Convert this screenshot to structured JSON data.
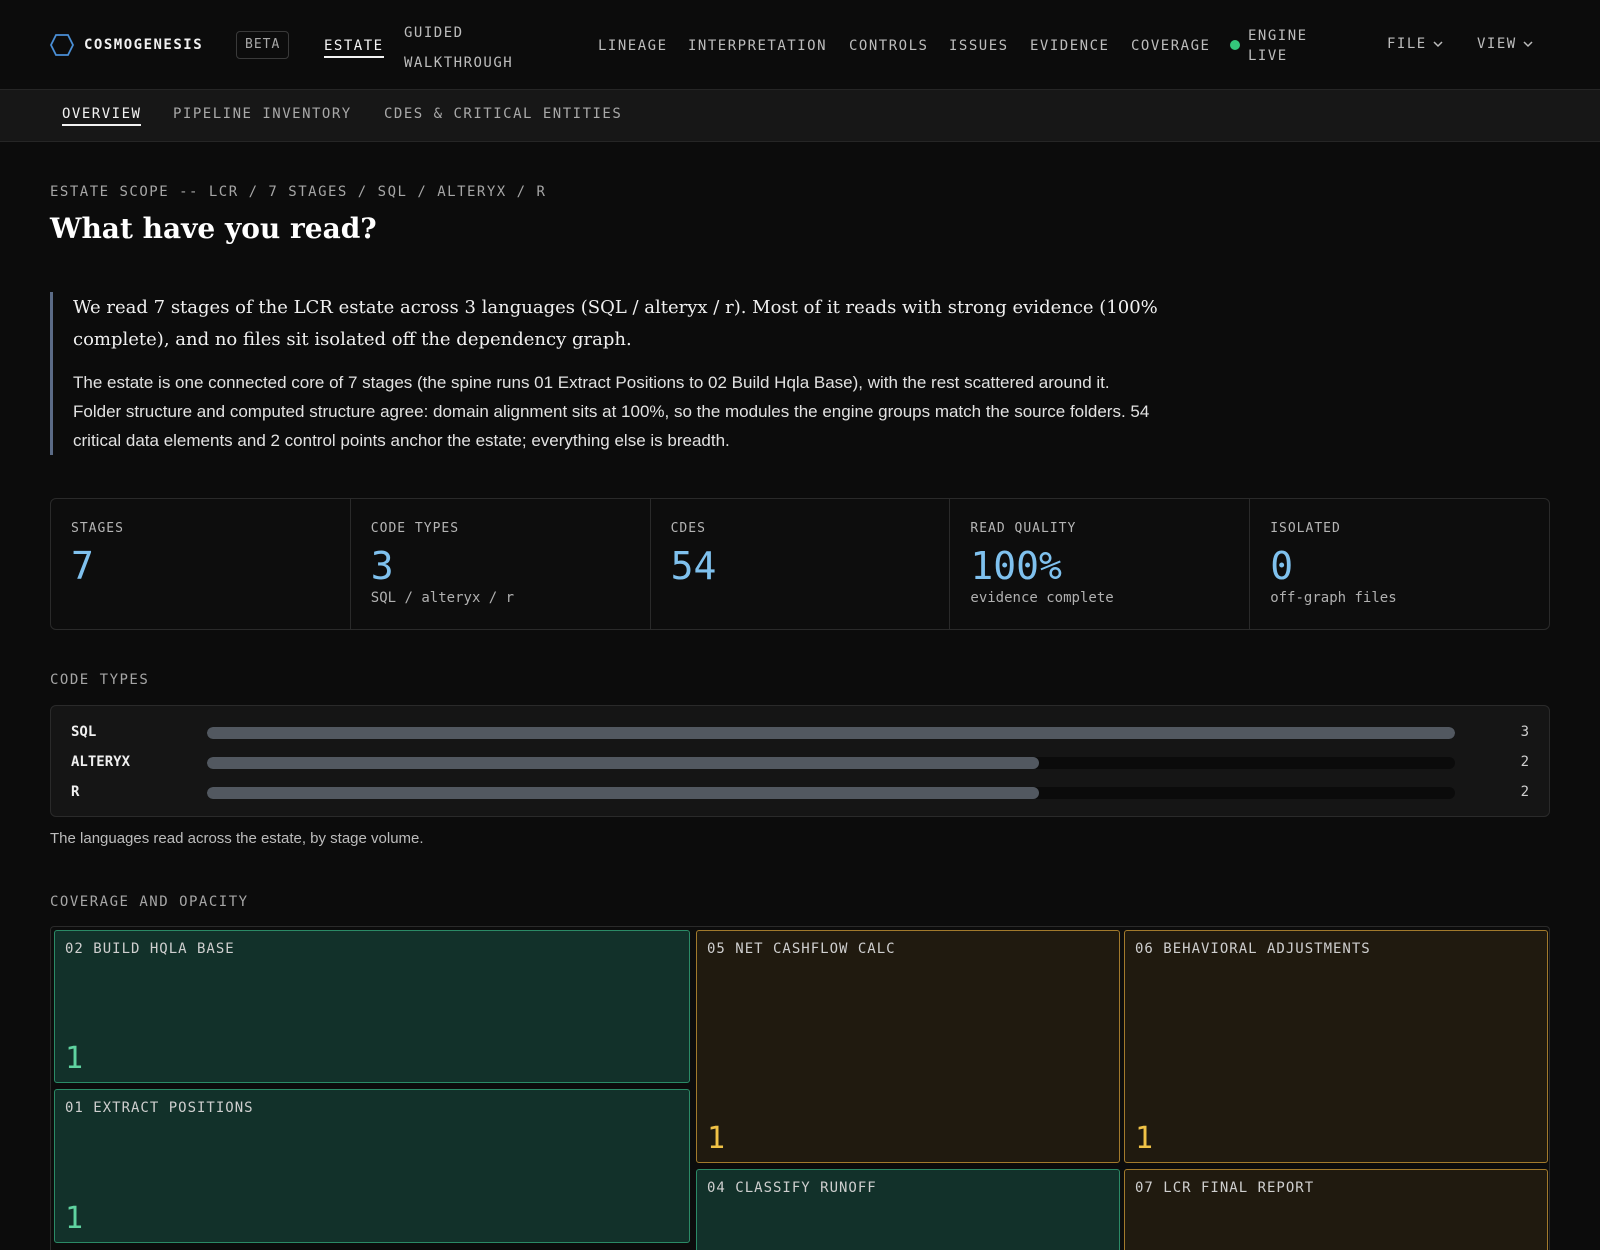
{
  "nav": {
    "brand": "COSMOGENESIS",
    "badge": "BETA",
    "links": {
      "estate": "ESTATE",
      "guided": "GUIDED WALKTHROUGH",
      "lineage": "LINEAGE",
      "interpretation": "INTERPRETATION",
      "controls": "CONTROLS",
      "issues": "ISSUES",
      "evidence": "EVIDENCE",
      "coverage": "COVERAGE"
    },
    "engine_status": "ENGINE LIVE",
    "engine_color": "#34c77b",
    "file_menu": "FILE",
    "view_menu": "VIEW"
  },
  "subnav": {
    "overview": "OVERVIEW",
    "pipeline": "PIPELINE INVENTORY",
    "cdes": "CDES & CRITICAL ENTITIES"
  },
  "header": {
    "scope": "ESTATE SCOPE -- LCR / 7 STAGES / SQL / ALTERYX / R",
    "title": "What have you read?"
  },
  "summary": {
    "lead": "We read 7 stages of the LCR estate across 3 languages (SQL / alteryx / r). Most of it reads with strong evidence (100% complete), and no files sit isolated off the dependency graph.",
    "body": "The estate is one connected core of 7 stages (the spine runs 01 Extract Positions to 02 Build Hqla Base), with the rest scattered around it. Folder structure and computed structure agree: domain alignment sits at 100%, so the modules the engine groups match the source folders. 54 critical data elements and 2 control points anchor the estate; everything else is breadth."
  },
  "stats": {
    "stages": {
      "label": "STAGES",
      "value": "7"
    },
    "code_types": {
      "label": "CODE TYPES",
      "value": "3",
      "sub": "SQL / alteryx / r"
    },
    "cdes": {
      "label": "CDES",
      "value": "54"
    },
    "read_quality": {
      "label": "READ QUALITY",
      "value": "100%",
      "sub": "evidence complete"
    },
    "isolated": {
      "label": "ISOLATED",
      "value": "0",
      "sub": "off-graph files"
    }
  },
  "code_types": {
    "section_label": "CODE TYPES",
    "caption": "The languages read across the estate, by stage volume.",
    "max": 3,
    "rows": [
      {
        "name": "SQL",
        "count": 3
      },
      {
        "name": "ALTERYX",
        "count": 2
      },
      {
        "name": "R",
        "count": 2
      }
    ]
  },
  "coverage": {
    "section_label": "COVERAGE AND OPACITY",
    "colors": {
      "green": "#12312a",
      "amber": "#201a0f"
    },
    "tiles": [
      {
        "title": "02 BUILD HQLA BASE",
        "count": "1",
        "status": "green"
      },
      {
        "title": "01 EXTRACT POSITIONS",
        "count": "1",
        "status": "green"
      },
      {
        "title": "05 NET CASHFLOW CALC",
        "count": "1",
        "status": "amber"
      },
      {
        "title": "06 BEHAVIORAL ADJUSTMENTS",
        "count": "1",
        "status": "amber"
      },
      {
        "title": "04 CLASSIFY RUNOFF",
        "count": "",
        "status": "green"
      },
      {
        "title": "07 LCR FINAL REPORT",
        "count": "",
        "status": "amber"
      }
    ]
  }
}
